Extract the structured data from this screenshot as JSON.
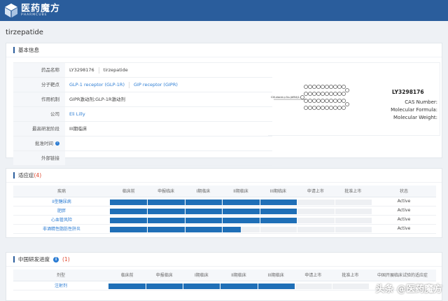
{
  "brand": {
    "name_cn": "医药魔方",
    "name_en": "PHARMCUBE"
  },
  "drug_title": "tirzepatide",
  "basic": {
    "heading": "基本信息",
    "rows": [
      {
        "key": "药品名称",
        "values": [
          "LY3298176",
          "tirzepatide"
        ]
      },
      {
        "key": "分子靶点",
        "values": [
          "GLP-1 receptor (GLP-1R)",
          "GIP receptor (GIPR)"
        ]
      },
      {
        "key": "作用机制",
        "values": [
          "GIPR激动剂;GLP-1R激动剂"
        ]
      },
      {
        "key": "公司",
        "values": [
          "Eli Lilly"
        ]
      },
      {
        "key": "最高研发阶段",
        "values": [
          "III期临床"
        ]
      },
      {
        "key": "批准时间",
        "values": [
          ""
        ]
      },
      {
        "key": "外部链接",
        "values": [
          ""
        ]
      }
    ],
    "molecule": {
      "name": "LY3298176",
      "cas": "CAS Number:",
      "formula": "Molecular Formula:",
      "weight": "Molecular Weight:",
      "struct_label": "C20-diacid-γ-Glu-(AEEA)2-"
    }
  },
  "indications": {
    "heading": "适应症",
    "count": "(4)",
    "columns": [
      "疾病",
      "临床前",
      "申报临床",
      "I期临床",
      "II期临床",
      "III期临床",
      "申请上市",
      "批准上市",
      "状态"
    ],
    "rows": [
      {
        "name": "II型糖尿病",
        "progress": 5,
        "status": "Active"
      },
      {
        "name": "肥胖",
        "progress": 5,
        "status": "Active"
      },
      {
        "name": "心血管风险",
        "progress": 5,
        "status": "Active"
      },
      {
        "name": "非酒精性脂肪性肝炎",
        "progress": 3.5,
        "status": "Active"
      }
    ]
  },
  "china": {
    "heading": "中国研发进度",
    "count": "(1)",
    "columns": [
      "剂型",
      "临床前",
      "申报临床",
      "I期临床",
      "II期临床",
      "III期临床",
      "申请上市",
      "批准上市",
      "中国开展临床试验的适应症"
    ],
    "rows": [
      {
        "name": "注射剂",
        "progress": 5,
        "status": ""
      }
    ]
  },
  "watermark": "头条 @医药魔方",
  "colors": {
    "brand": "#2a5d9c",
    "bar": "#1f6fb7",
    "link": "#2b7cd3",
    "count": "#e0452b"
  }
}
